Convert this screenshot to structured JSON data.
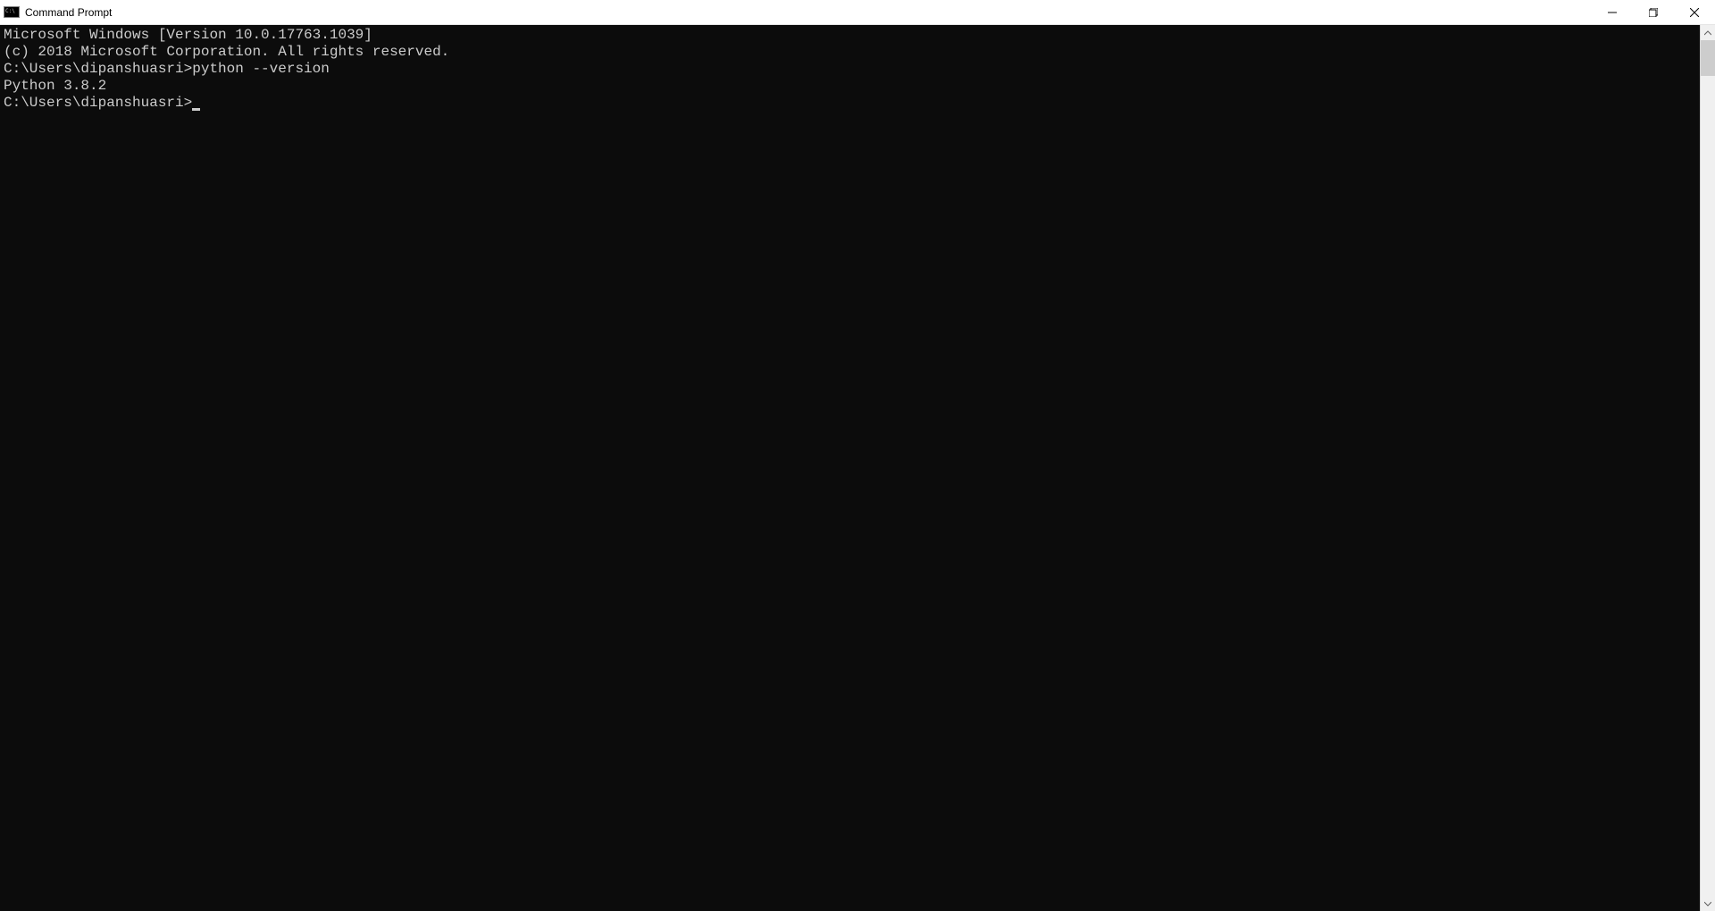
{
  "titlebar": {
    "title": "Command Prompt"
  },
  "terminal": {
    "line_version": "Microsoft Windows [Version 10.0.17763.1039]",
    "line_copyright": "(c) 2018 Microsoft Corporation. All rights reserved.",
    "line_blank1": "",
    "line_prompt1": "C:\\Users\\dipanshuasri>python --version",
    "line_output1": "Python 3.8.2",
    "line_blank2": "",
    "line_prompt2": "C:\\Users\\dipanshuasri>"
  }
}
